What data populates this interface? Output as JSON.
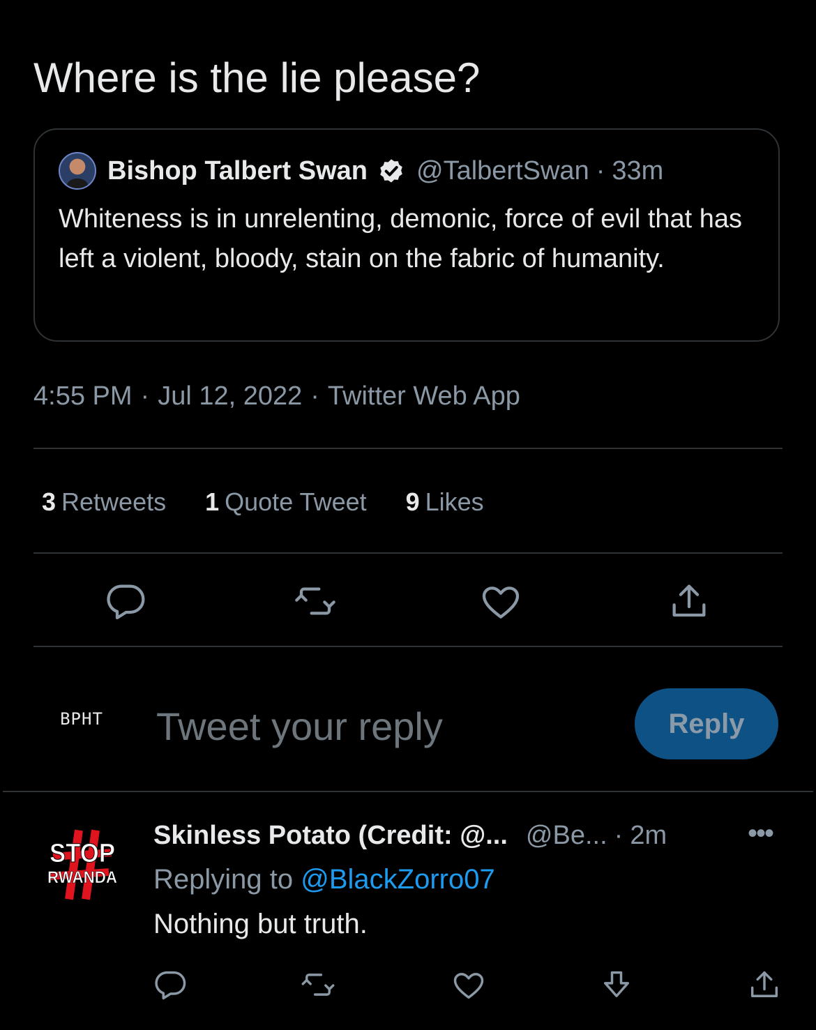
{
  "tweet": {
    "text": "Where is the lie please?"
  },
  "quoted_tweet": {
    "author_name": "Bishop Talbert Swan",
    "handle": "@TalbertSwan",
    "separator": "·",
    "time": "33m",
    "verified": true,
    "body": "Whiteness is in unrelenting, demonic, force of evil that has left a violent, bloody, stain on the fabric of humanity."
  },
  "meta": {
    "time": "4:55 PM",
    "date": "Jul 12, 2022",
    "source": "Twitter Web App",
    "separator": "·"
  },
  "stats": {
    "retweets_count": "3",
    "retweets_label": "Retweets",
    "quotes_count": "1",
    "quotes_label": "Quote Tweet",
    "likes_count": "9",
    "likes_label": "Likes"
  },
  "actions": [
    "comment-icon",
    "retweet-icon",
    "heart-icon",
    "share-icon"
  ],
  "composer": {
    "avatar_text": "BPHT",
    "placeholder": "Tweet your reply",
    "button_label": "Reply"
  },
  "reply": {
    "author_name": "Skinless Potato (Credit: @...",
    "handle": "@Be...",
    "separator": "·",
    "time": "2m",
    "more": "•••",
    "replying_prefix": "Replying to",
    "replying_to": "@BlackZorro07",
    "text": "Nothing but truth.",
    "avatar_line1": "STOP",
    "avatar_line2": "RWANDA",
    "actions": [
      "comment-icon",
      "retweet-icon",
      "heart-icon",
      "downvote-icon",
      "share-icon"
    ]
  },
  "colors": {
    "background": "#000000",
    "text": "#e7e9ea",
    "muted": "#8b98a5",
    "divider": "#2f3336",
    "link": "#1d9bf0",
    "reply_button_bg": "#0e5184"
  }
}
